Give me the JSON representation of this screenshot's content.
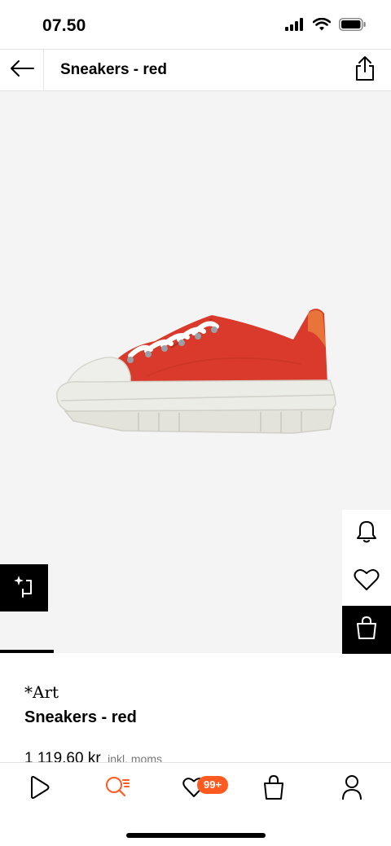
{
  "status_bar": {
    "time": "07.50"
  },
  "nav": {
    "title": "Sneakers - red"
  },
  "product": {
    "brand": "*Art",
    "name": "Sneakers - red",
    "price": "1 119,60 kr",
    "price_note": "inkl. moms"
  },
  "tab_bar": {
    "wishlist_badge": "99+"
  },
  "colors": {
    "accent": "#ff5a1f",
    "shoe_red": "#d93a2b",
    "background": "#f4f4f4"
  }
}
